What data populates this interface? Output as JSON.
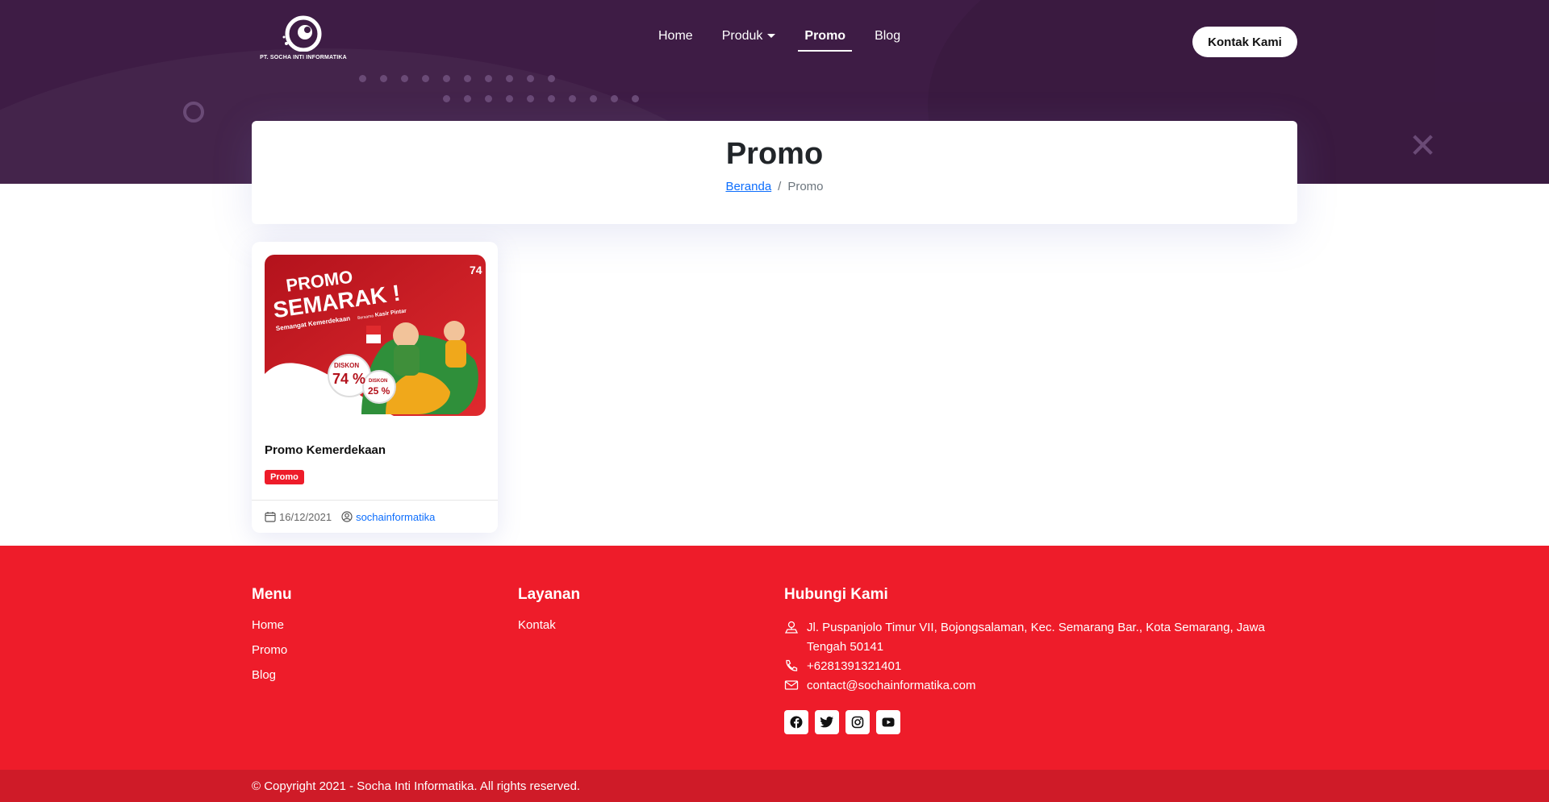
{
  "brand": {
    "logo_text": "PT. SOCHA INTI INFORMATIKA"
  },
  "nav": {
    "items": [
      {
        "label": "Home"
      },
      {
        "label": "Produk"
      },
      {
        "label": "Promo"
      },
      {
        "label": "Blog"
      }
    ],
    "active": "Promo",
    "cta_label": "Kontak Kami"
  },
  "page_header": {
    "title": "Promo",
    "breadcrumb": {
      "home": "Beranda",
      "separator": "/",
      "current": "Promo"
    }
  },
  "promo_card": {
    "image_text": {
      "headline_1": "PROMO",
      "headline_2": "SEMARAK !",
      "tagline_1": "Semangat Kemerdekaan",
      "tagline_2": "Bersama",
      "tagline_3": "Kasir Pintar",
      "discount_label_1": "DISKON",
      "discount_value_1": "74 %",
      "discount_label_2": "DISKON",
      "discount_value_2": "25 %",
      "corner_number": "74"
    },
    "title": "Promo Kemerdekaan",
    "badge": "Promo",
    "date": "16/12/2021",
    "author": "sochainformatika"
  },
  "footer": {
    "menu": {
      "heading": "Menu",
      "links": [
        "Home",
        "Promo",
        "Blog"
      ]
    },
    "services": {
      "heading": "Layanan",
      "links": [
        "Kontak"
      ]
    },
    "contact": {
      "heading": "Hubungi Kami",
      "address": "Jl. Puspanjolo Timur VII, Bojongsalaman, Kec. Semarang Bar., Kota Semarang, Jawa Tengah 50141",
      "phone": "+6281391321401",
      "email": "contact@sochainformatika.com"
    },
    "socials": [
      "facebook-icon",
      "twitter-icon",
      "instagram-icon",
      "youtube-icon"
    ],
    "copyright": "© Copyright 2021 - Socha Inti Informatika. All rights reserved."
  },
  "colors": {
    "hero_bg": "#3e1c45",
    "footer_red": "#ee1c2a",
    "copyright_red": "#cf1b28",
    "link_blue": "#0d6efd"
  }
}
